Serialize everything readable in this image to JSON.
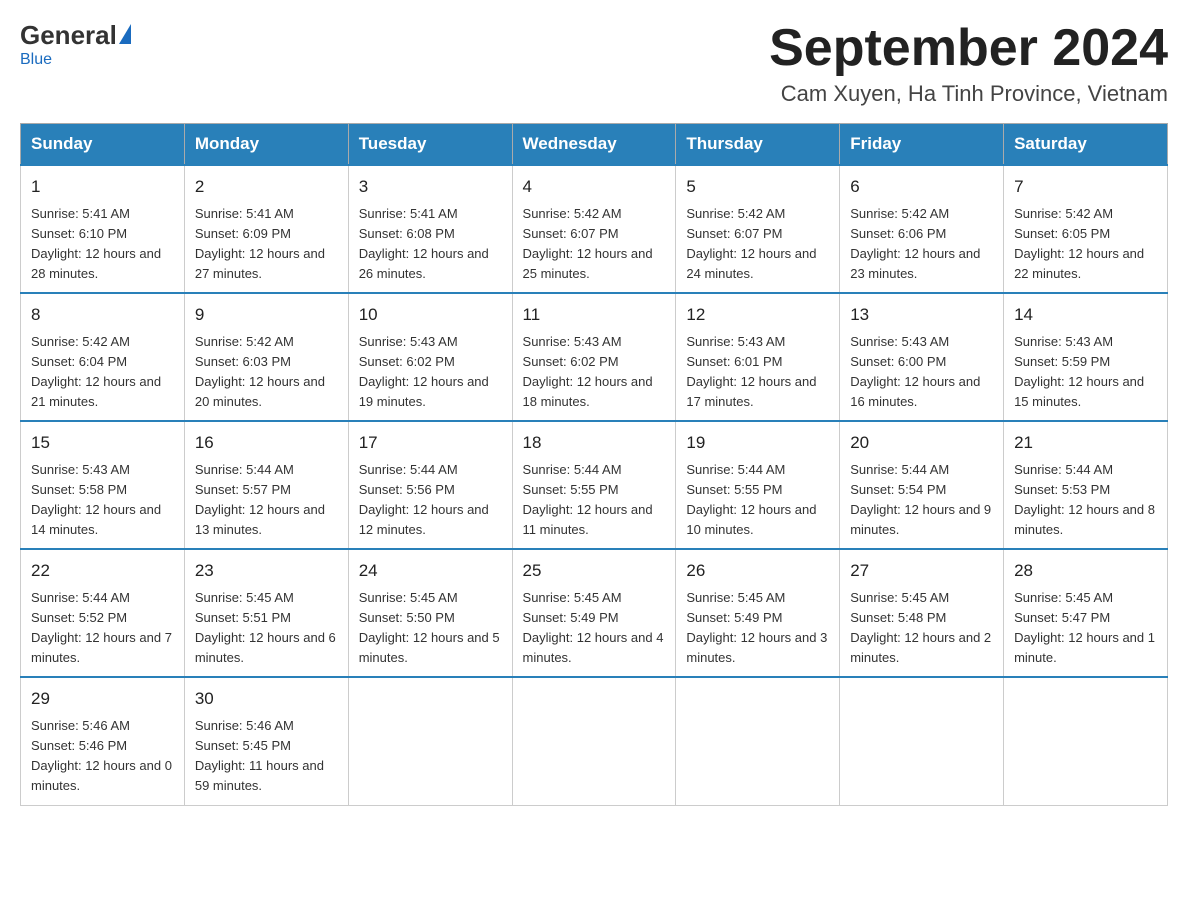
{
  "header": {
    "logo_general": "General",
    "logo_blue": "Blue",
    "month_title": "September 2024",
    "location": "Cam Xuyen, Ha Tinh Province, Vietnam"
  },
  "days_of_week": [
    "Sunday",
    "Monday",
    "Tuesday",
    "Wednesday",
    "Thursday",
    "Friday",
    "Saturday"
  ],
  "weeks": [
    [
      {
        "day": "1",
        "sunrise": "5:41 AM",
        "sunset": "6:10 PM",
        "daylight": "12 hours and 28 minutes."
      },
      {
        "day": "2",
        "sunrise": "5:41 AM",
        "sunset": "6:09 PM",
        "daylight": "12 hours and 27 minutes."
      },
      {
        "day": "3",
        "sunrise": "5:41 AM",
        "sunset": "6:08 PM",
        "daylight": "12 hours and 26 minutes."
      },
      {
        "day": "4",
        "sunrise": "5:42 AM",
        "sunset": "6:07 PM",
        "daylight": "12 hours and 25 minutes."
      },
      {
        "day": "5",
        "sunrise": "5:42 AM",
        "sunset": "6:07 PM",
        "daylight": "12 hours and 24 minutes."
      },
      {
        "day": "6",
        "sunrise": "5:42 AM",
        "sunset": "6:06 PM",
        "daylight": "12 hours and 23 minutes."
      },
      {
        "day": "7",
        "sunrise": "5:42 AM",
        "sunset": "6:05 PM",
        "daylight": "12 hours and 22 minutes."
      }
    ],
    [
      {
        "day": "8",
        "sunrise": "5:42 AM",
        "sunset": "6:04 PM",
        "daylight": "12 hours and 21 minutes."
      },
      {
        "day": "9",
        "sunrise": "5:42 AM",
        "sunset": "6:03 PM",
        "daylight": "12 hours and 20 minutes."
      },
      {
        "day": "10",
        "sunrise": "5:43 AM",
        "sunset": "6:02 PM",
        "daylight": "12 hours and 19 minutes."
      },
      {
        "day": "11",
        "sunrise": "5:43 AM",
        "sunset": "6:02 PM",
        "daylight": "12 hours and 18 minutes."
      },
      {
        "day": "12",
        "sunrise": "5:43 AM",
        "sunset": "6:01 PM",
        "daylight": "12 hours and 17 minutes."
      },
      {
        "day": "13",
        "sunrise": "5:43 AM",
        "sunset": "6:00 PM",
        "daylight": "12 hours and 16 minutes."
      },
      {
        "day": "14",
        "sunrise": "5:43 AM",
        "sunset": "5:59 PM",
        "daylight": "12 hours and 15 minutes."
      }
    ],
    [
      {
        "day": "15",
        "sunrise": "5:43 AM",
        "sunset": "5:58 PM",
        "daylight": "12 hours and 14 minutes."
      },
      {
        "day": "16",
        "sunrise": "5:44 AM",
        "sunset": "5:57 PM",
        "daylight": "12 hours and 13 minutes."
      },
      {
        "day": "17",
        "sunrise": "5:44 AM",
        "sunset": "5:56 PM",
        "daylight": "12 hours and 12 minutes."
      },
      {
        "day": "18",
        "sunrise": "5:44 AM",
        "sunset": "5:55 PM",
        "daylight": "12 hours and 11 minutes."
      },
      {
        "day": "19",
        "sunrise": "5:44 AM",
        "sunset": "5:55 PM",
        "daylight": "12 hours and 10 minutes."
      },
      {
        "day": "20",
        "sunrise": "5:44 AM",
        "sunset": "5:54 PM",
        "daylight": "12 hours and 9 minutes."
      },
      {
        "day": "21",
        "sunrise": "5:44 AM",
        "sunset": "5:53 PM",
        "daylight": "12 hours and 8 minutes."
      }
    ],
    [
      {
        "day": "22",
        "sunrise": "5:44 AM",
        "sunset": "5:52 PM",
        "daylight": "12 hours and 7 minutes."
      },
      {
        "day": "23",
        "sunrise": "5:45 AM",
        "sunset": "5:51 PM",
        "daylight": "12 hours and 6 minutes."
      },
      {
        "day": "24",
        "sunrise": "5:45 AM",
        "sunset": "5:50 PM",
        "daylight": "12 hours and 5 minutes."
      },
      {
        "day": "25",
        "sunrise": "5:45 AM",
        "sunset": "5:49 PM",
        "daylight": "12 hours and 4 minutes."
      },
      {
        "day": "26",
        "sunrise": "5:45 AM",
        "sunset": "5:49 PM",
        "daylight": "12 hours and 3 minutes."
      },
      {
        "day": "27",
        "sunrise": "5:45 AM",
        "sunset": "5:48 PM",
        "daylight": "12 hours and 2 minutes."
      },
      {
        "day": "28",
        "sunrise": "5:45 AM",
        "sunset": "5:47 PM",
        "daylight": "12 hours and 1 minute."
      }
    ],
    [
      {
        "day": "29",
        "sunrise": "5:46 AM",
        "sunset": "5:46 PM",
        "daylight": "12 hours and 0 minutes."
      },
      {
        "day": "30",
        "sunrise": "5:46 AM",
        "sunset": "5:45 PM",
        "daylight": "11 hours and 59 minutes."
      },
      null,
      null,
      null,
      null,
      null
    ]
  ]
}
